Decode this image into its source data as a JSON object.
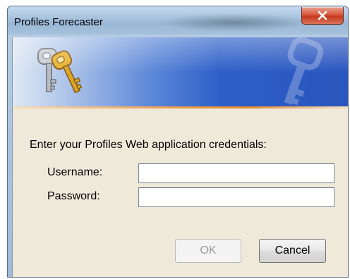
{
  "window": {
    "title": "Profiles Forecaster"
  },
  "titlebar": {
    "close_icon": "close-icon"
  },
  "banner": {
    "icon": "keys-icon",
    "watermark_icon": "keys-watermark-icon"
  },
  "form": {
    "prompt": "Enter your Profiles Web application credentials:",
    "username_label": "Username:",
    "username_value": "",
    "password_label": "Password:",
    "password_value": ""
  },
  "buttons": {
    "ok_label": "OK",
    "cancel_label": "Cancel"
  },
  "colors": {
    "banner_start": "#dfe8f4",
    "banner_end": "#2a55bd",
    "accent_line": "#e58a2e",
    "client_bg": "#efe9da",
    "close_button": "#c5381d"
  }
}
